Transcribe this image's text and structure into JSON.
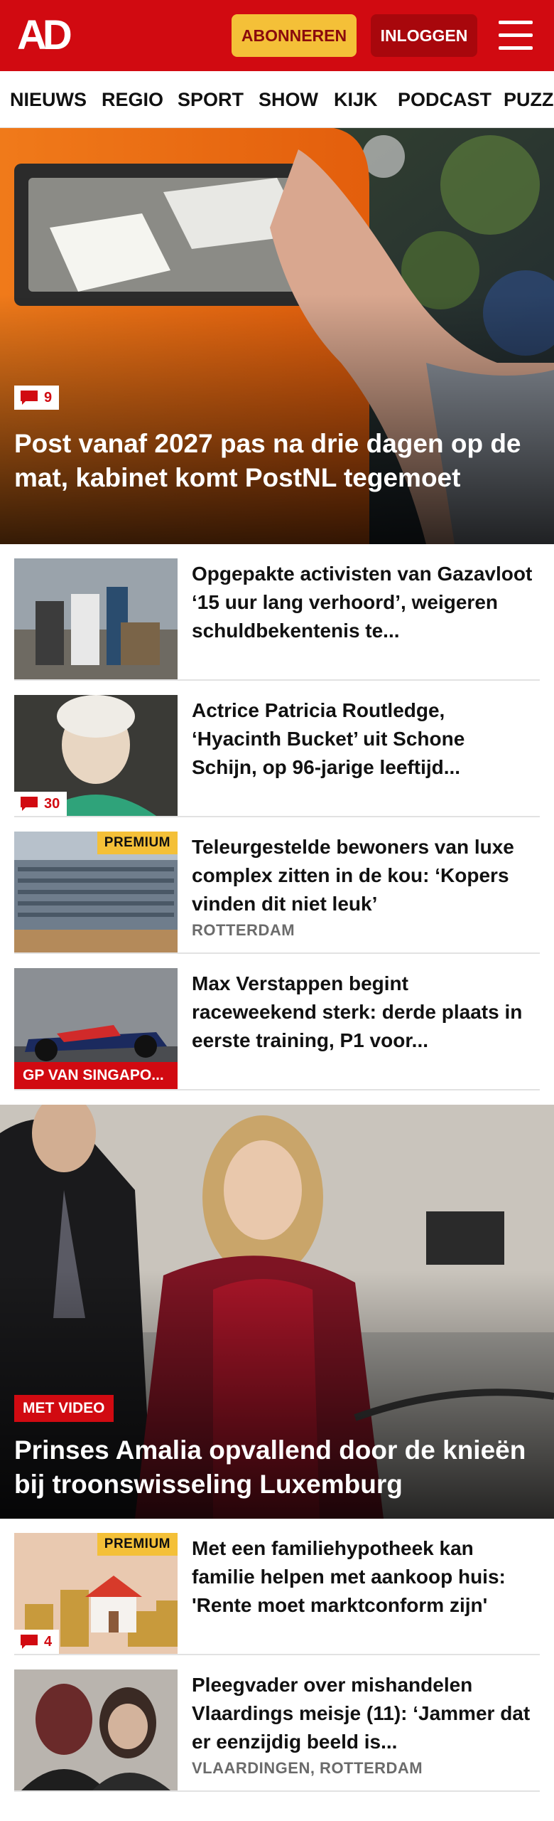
{
  "header": {
    "logo": "AD",
    "subscribe_label": "ABONNEREN",
    "login_label": "INLOGGEN",
    "brand_color": "#d10a11",
    "accent_color": "#f4c038"
  },
  "nav": {
    "items": [
      {
        "label": "NIEUWS"
      },
      {
        "label": "REGIO"
      },
      {
        "label": "SPORT"
      },
      {
        "label": "SHOW"
      },
      {
        "label": "KIJK"
      },
      {
        "label": "PODCAST"
      },
      {
        "label": "PUZZ"
      }
    ]
  },
  "hero1": {
    "comments": "9",
    "title": "Post vanaf 2027 pas na drie dagen op de mat, kabinet komt PostNL tegemoet"
  },
  "articles": [
    {
      "title": "Opgepakte activisten van Gazavloot ‘15 uur lang verhoord’, weigeren schuldbekentenis te..."
    },
    {
      "title": "Actrice Patricia Routledge, ‘Hyacinth Bucket’ uit Schone Schijn, op 96-jarige leeftijd...",
      "comments": "30"
    },
    {
      "title": "Teleurgestelde bewoners van luxe complex zitten in de kou: ‘Kopers vinden dit niet leuk’",
      "premium": "PREMIUM",
      "location": "ROTTERDAM"
    },
    {
      "title": "Max Verstappen begint raceweekend sterk: derde plaats in eerste training, P1 voor...",
      "label": "GP VAN SINGAPO..."
    }
  ],
  "hero2": {
    "label": "MET VIDEO",
    "title": "Prinses Amalia opvallend door de knieën bij troonswisseling Luxemburg"
  },
  "articles2": [
    {
      "title": "Met een familiehypotheek kan familie helpen met aankoop huis: 'Rente moet marktconform zijn'",
      "premium": "PREMIUM",
      "comments": "4"
    },
    {
      "title": "Pleegvader over mishandelen Vlaardings meisje (11): ‘Jammer dat er eenzijdig beeld is...",
      "location": "VLAARDINGEN, ROTTERDAM"
    }
  ]
}
